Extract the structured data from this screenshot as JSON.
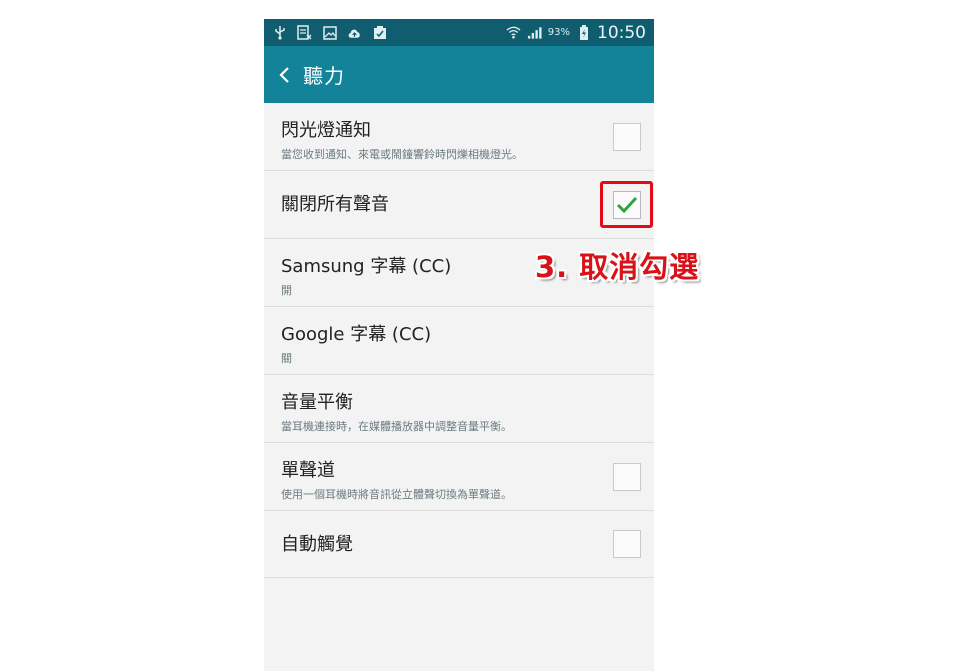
{
  "status_bar": {
    "icons": [
      "usb-icon",
      "notification-icon",
      "image-icon",
      "cloud-upload-icon",
      "clipboard-check-icon",
      "wifi-icon",
      "signal-icon",
      "battery-icon"
    ],
    "battery": "93%",
    "time": "10:50"
  },
  "app_bar": {
    "title": "聽力"
  },
  "settings": [
    {
      "title": "閃光燈通知",
      "subtitle": "當您收到通知、來電或鬧鐘響鈴時閃爍相機燈光。",
      "checkbox": false
    },
    {
      "title": "關閉所有聲音",
      "subtitle": "",
      "checkbox": true
    },
    {
      "title": "Samsung 字幕 (CC)",
      "subtitle": "開"
    },
    {
      "title": "Google 字幕 (CC)",
      "subtitle": "關"
    },
    {
      "title": "音量平衡",
      "subtitle": "當耳機連接時，在媒體播放器中調整音量平衡。"
    },
    {
      "title": "單聲道",
      "subtitle": "使用一個耳機時將音訊從立體聲切換為單聲道。",
      "checkbox": false
    },
    {
      "title": "自動觸覺",
      "subtitle": "",
      "checkbox": false
    }
  ],
  "annotation": {
    "text": "3. 取消勾選",
    "color": "#d81218"
  },
  "colors": {
    "status_bar_bg": "#0f5d6e",
    "app_bar_bg": "#13839a",
    "check_green": "#2aa63a"
  }
}
